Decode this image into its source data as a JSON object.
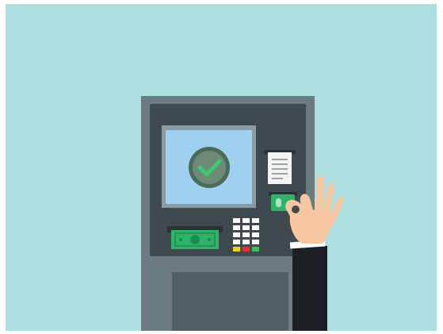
{
  "scene": {
    "description_items": {
      "screen_icon": "check-circle-icon",
      "receipt_icon": "receipt-icon",
      "card_icon": "card-icon",
      "cash_icon": "banknote-icon",
      "keypad_icon": "keypad-icon",
      "hand_icon": "ok-hand-icon"
    }
  },
  "colors": {
    "background": "#aedfe0",
    "atm_outer": "#6b7b82",
    "atm_panel": "#3f4a4f",
    "screen_frame": "#8c9ba1",
    "screen": "#9ed0f0",
    "check_circle_fill": "#6d8a78",
    "check_circle_ring": "#4c6a58",
    "check_mark": "#3ec86f",
    "cash_green": "#2fb36a",
    "keypad_key": "#ffffff",
    "key_yellow": "#f1d21a",
    "key_red": "#e0303a",
    "key_green": "#34c35a",
    "receipt": "#f3f3f3",
    "receipt_lines": "#9aa4a8",
    "skin": "#f6c6a1",
    "sleeve": "#1c1f24",
    "cuff": "#ffffff",
    "lower_panel": "#525f65"
  }
}
